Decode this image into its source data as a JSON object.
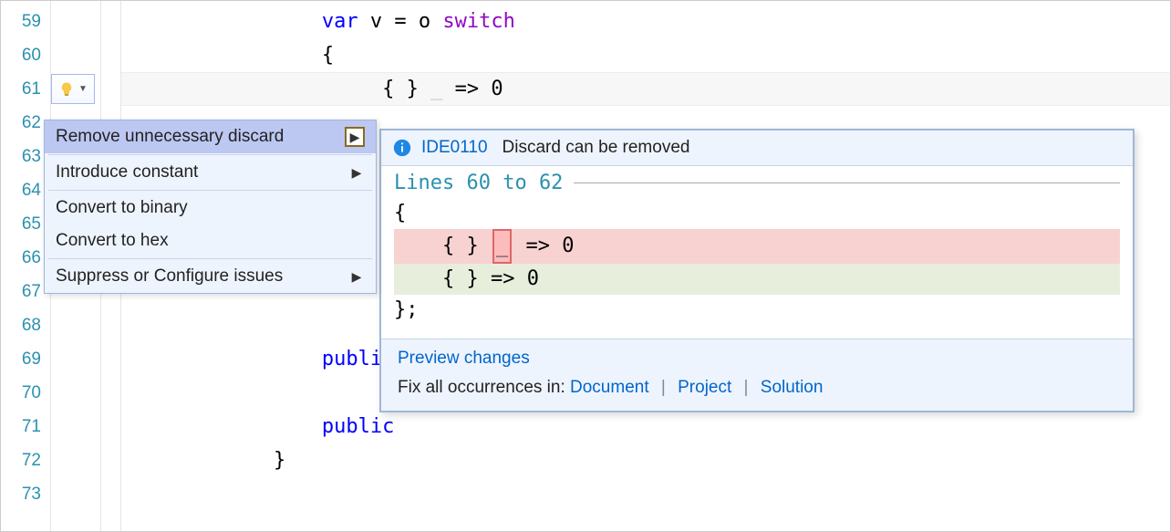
{
  "gutter": {
    "start": 59,
    "end": 73,
    "lines": [
      "59",
      "60",
      "61",
      "62",
      "63",
      "64",
      "65",
      "66",
      "67",
      "68",
      "69",
      "70",
      "71",
      "72",
      "73"
    ]
  },
  "code": {
    "l59": {
      "kw": "var",
      "rest1": " v = o ",
      "sw": "switch"
    },
    "l60": "{",
    "l61": {
      "pat": "{ } ",
      "discard": "_",
      "rest": " => 0"
    },
    "l69": "public",
    "l71": "public",
    "l72": "}"
  },
  "quick_actions": {
    "items": [
      {
        "label": "Remove unnecessary discard",
        "has_submenu": true,
        "selected": true
      },
      {
        "label": "Introduce constant",
        "has_submenu": true
      },
      {
        "label": "Convert to binary"
      },
      {
        "label": "Convert to hex"
      },
      {
        "label": "Suppress or Configure issues",
        "has_submenu": true
      }
    ]
  },
  "preview": {
    "diag_id": "IDE0110",
    "diag_msg": "Discard can be removed",
    "range_label": "Lines 60 to 62",
    "code_before_open": "{",
    "code_del": {
      "pre": "    { } ",
      "hl": "_",
      "post": " => 0"
    },
    "code_add": "    { } => 0",
    "code_after_close": "};",
    "footer": {
      "preview_link": "Preview changes",
      "fix_prefix": "Fix all occurrences in: ",
      "scope_document": "Document",
      "scope_project": "Project",
      "scope_solution": "Solution"
    }
  }
}
